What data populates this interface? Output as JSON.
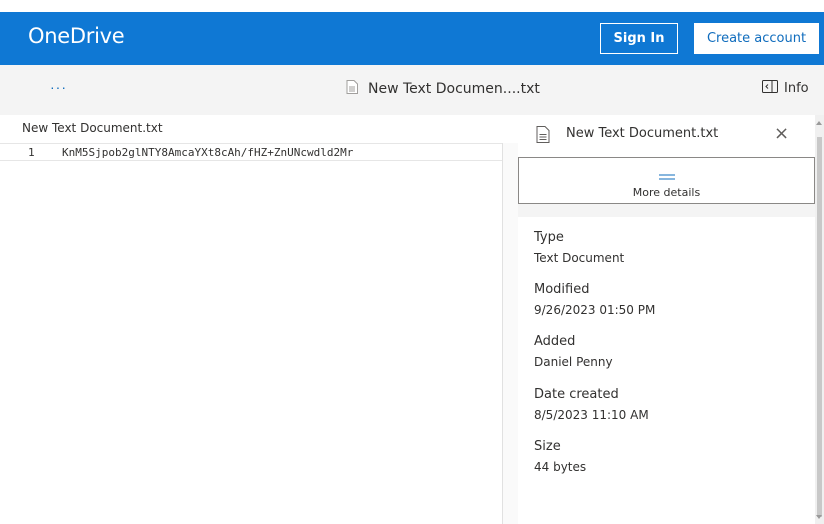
{
  "header": {
    "brand": "OneDrive",
    "sign_in": "Sign In",
    "create_account": "Create account"
  },
  "commandbar": {
    "more": "···",
    "document_title": "New Text Documen....txt",
    "info": "Info"
  },
  "editor": {
    "title": "New Text Document.txt",
    "lines": [
      {
        "number": "1",
        "text": "KnM5Sjpob2glNTY8AmcaYXt8cAh/fHZ+ZnUNcwdld2Mr"
      }
    ]
  },
  "panel": {
    "file_name": "New Text Document.txt",
    "close": "×",
    "more_details": "More details",
    "fields": {
      "type": {
        "label": "Type",
        "value": "Text Document"
      },
      "modified": {
        "label": "Modified",
        "value": "9/26/2023 01:50 PM"
      },
      "added": {
        "label": "Added",
        "value": "Daniel Penny"
      },
      "created": {
        "label": "Date created",
        "value": "8/5/2023 11:10 AM"
      },
      "size": {
        "label": "Size",
        "value": "44 bytes"
      }
    }
  },
  "icons": {
    "document": "document-icon",
    "info": "info-panel-icon",
    "details": "details-bars-icon"
  },
  "colors": {
    "brand_blue": "#0f78d4",
    "link_blue": "#0f6cbd",
    "command_bar": "#f4f4f4",
    "text": "#323130"
  }
}
